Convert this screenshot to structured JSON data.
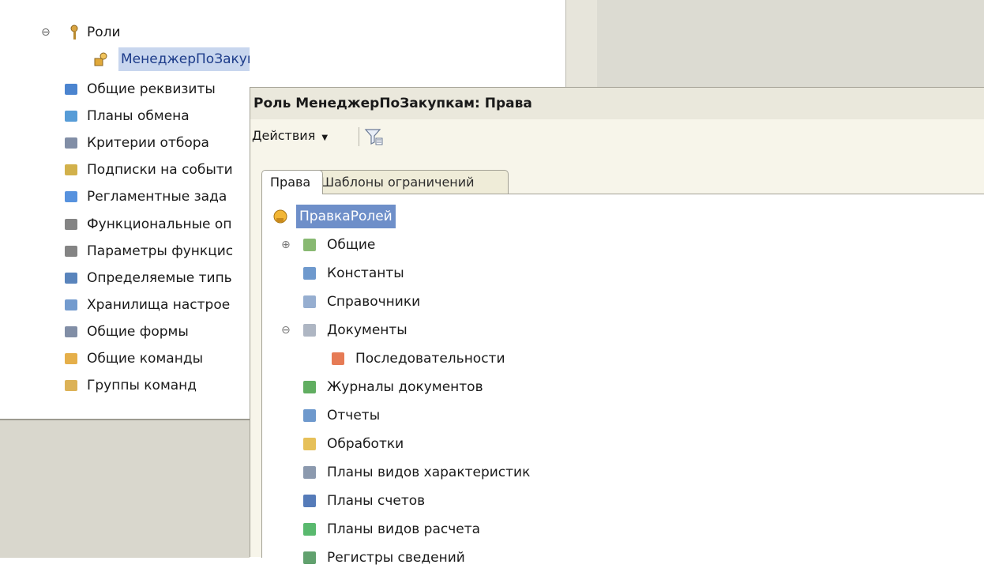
{
  "left_tree": {
    "roles_group": "Роли",
    "selected_role": "МенеджерПоЗакупкам",
    "items": [
      {
        "label": "Общие реквизиты",
        "icon": "attributes-icon"
      },
      {
        "label": "Планы обмена",
        "icon": "exchange-plan-icon"
      },
      {
        "label": "Критерии отбора",
        "icon": "filter-criteria-icon"
      },
      {
        "label": "Подписки на событи",
        "icon": "event-subscription-icon"
      },
      {
        "label": "Регламентные зада",
        "icon": "scheduled-job-icon"
      },
      {
        "label": "Функциональные оп",
        "icon": "functional-option-icon"
      },
      {
        "label": "Параметры функцис",
        "icon": "functional-parameter-icon"
      },
      {
        "label": "Определяемые типь",
        "icon": "defined-type-icon"
      },
      {
        "label": "Хранилища настрое",
        "icon": "settings-storage-icon"
      },
      {
        "label": "Общие формы",
        "icon": "common-form-icon"
      },
      {
        "label": "Общие команды",
        "icon": "common-command-icon"
      },
      {
        "label": "Группы команд",
        "icon": "command-group-icon"
      }
    ]
  },
  "window": {
    "title": "Роль МенеджерПоЗакупкам: Права",
    "actions_label": "Действия",
    "tabs": [
      {
        "label": "Права",
        "active": true
      },
      {
        "label": "Шаблоны ограничений",
        "active": false
      }
    ]
  },
  "rights_tree": {
    "root": "ПравкаРолей",
    "items": [
      {
        "label": "Общие",
        "icon": "common-icon",
        "expander": "⊕"
      },
      {
        "label": "Константы",
        "icon": "constants-icon",
        "expander": ""
      },
      {
        "label": "Справочники",
        "icon": "catalogs-icon",
        "expander": ""
      },
      {
        "label": "Документы",
        "icon": "documents-icon",
        "expander": "⊖"
      },
      {
        "label": "Последовательности",
        "icon": "sequences-icon",
        "expander": ""
      },
      {
        "label": "Журналы документов",
        "icon": "document-journals-icon",
        "expander": ""
      },
      {
        "label": "Отчеты",
        "icon": "reports-icon",
        "expander": ""
      },
      {
        "label": "Обработки",
        "icon": "data-processors-icon",
        "expander": ""
      },
      {
        "label": "Планы видов характеристик",
        "icon": "chart-of-characteristics-icon",
        "expander": ""
      },
      {
        "label": "Планы счетов",
        "icon": "chart-of-accounts-icon",
        "expander": ""
      },
      {
        "label": "Планы видов расчета",
        "icon": "chart-of-calculation-icon",
        "expander": ""
      },
      {
        "label": "Регистры сведений",
        "icon": "information-registers-icon",
        "expander": ""
      }
    ]
  },
  "colors": {
    "selection": "#c8d6ee",
    "selection_strong": "#6e8fc9",
    "window_bg": "#f2f0e4"
  }
}
